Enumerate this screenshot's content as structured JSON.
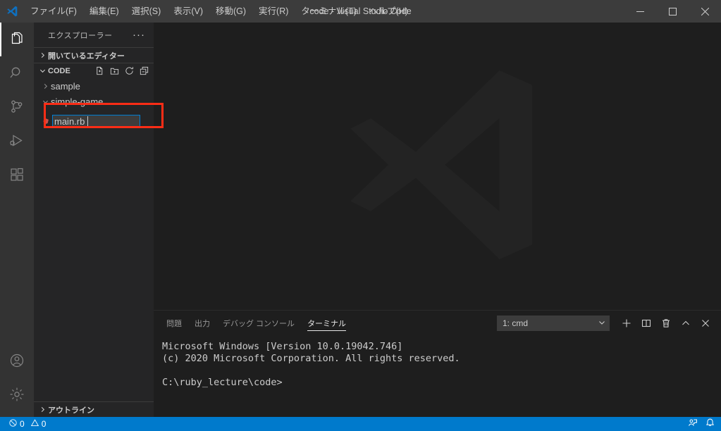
{
  "titlebar": {
    "logo_icon": "vscode-logo-icon",
    "window_title": "code - Visual Studio Code",
    "menus": [
      {
        "label": "ファイル(F)",
        "name": "menu-file"
      },
      {
        "label": "編集(E)",
        "name": "menu-edit"
      },
      {
        "label": "選択(S)",
        "name": "menu-selection"
      },
      {
        "label": "表示(V)",
        "name": "menu-view"
      },
      {
        "label": "移動(G)",
        "name": "menu-go"
      },
      {
        "label": "実行(R)",
        "name": "menu-run"
      },
      {
        "label": "ターミナル(T)",
        "name": "menu-terminal"
      },
      {
        "label": "ヘルプ(H)",
        "name": "menu-help"
      }
    ],
    "controls": {
      "minimize": "minimize-icon",
      "maximize": "maximize-icon",
      "close": "close-icon"
    }
  },
  "activitybar": {
    "items": [
      {
        "name": "activity-explorer",
        "icon": "files-icon",
        "active": true
      },
      {
        "name": "activity-search",
        "icon": "search-icon",
        "active": false
      },
      {
        "name": "activity-source-control",
        "icon": "source-control-icon",
        "active": false
      },
      {
        "name": "activity-run-debug",
        "icon": "run-debug-icon",
        "active": false
      },
      {
        "name": "activity-extensions",
        "icon": "extensions-icon",
        "active": false
      }
    ],
    "bottom_items": [
      {
        "name": "activity-account",
        "icon": "account-icon"
      },
      {
        "name": "activity-settings",
        "icon": "gear-icon"
      }
    ]
  },
  "sidebar": {
    "title": "エクスプローラー",
    "more_actions": "···",
    "open_editors": {
      "label": "開いているエディター",
      "expanded": false,
      "chevron": "›"
    },
    "folder": {
      "label": "CODE",
      "expanded": true,
      "chevron": "⌄",
      "actions": [
        {
          "name": "new-file-button",
          "icon": "new-file-icon"
        },
        {
          "name": "new-folder-button",
          "icon": "new-folder-icon"
        },
        {
          "name": "refresh-explorer-button",
          "icon": "refresh-icon"
        },
        {
          "name": "collapse-folders-button",
          "icon": "collapse-all-icon"
        }
      ]
    },
    "tree": [
      {
        "label": "sample",
        "expanded": false,
        "chevron": "›",
        "indent": 8
      },
      {
        "label": "simple-game",
        "expanded": true,
        "chevron": "⌄",
        "indent": 8
      }
    ],
    "new_file_input": {
      "value": "main.rb",
      "placeholder": "",
      "file_icon": "ruby-gem-icon",
      "focused": true
    },
    "outline": {
      "label": "アウトライン",
      "expanded": false,
      "chevron": "›"
    }
  },
  "editor": {
    "watermark_icon": "vscode-watermark-logo"
  },
  "panel": {
    "tabs": [
      {
        "label": "問題",
        "name": "tab-problems",
        "active": false
      },
      {
        "label": "出力",
        "name": "tab-output",
        "active": false
      },
      {
        "label": "デバッグ コンソール",
        "name": "tab-debug-console",
        "active": false
      },
      {
        "label": "ターミナル",
        "name": "tab-terminal",
        "active": true
      }
    ],
    "terminal_select": {
      "value": "1: cmd",
      "chevron": "⌄"
    },
    "actions": [
      {
        "name": "new-terminal-button",
        "icon": "plus-icon",
        "glyph": "+"
      },
      {
        "name": "split-terminal-button",
        "icon": "split-editor-icon"
      },
      {
        "name": "kill-terminal-button",
        "icon": "trash-icon"
      },
      {
        "name": "maximize-panel-button",
        "icon": "chevron-up-icon"
      },
      {
        "name": "close-panel-button",
        "icon": "close-icon"
      }
    ],
    "terminal_output": "Microsoft Windows [Version 10.0.19042.746]\n(c) 2020 Microsoft Corporation. All rights reserved.\n\nC:\\ruby_lecture\\code>"
  },
  "statusbar": {
    "errors": {
      "icon": "error-icon",
      "count": "0"
    },
    "warnings": {
      "icon": "warning-icon",
      "count": "0"
    },
    "right_items": [
      {
        "name": "feedback-button",
        "icon": "feedback-person-icon"
      },
      {
        "name": "notifications-button",
        "icon": "bell-icon"
      }
    ]
  },
  "annotation": {
    "color": "#ff2d16",
    "target": "new-file-name-input"
  }
}
